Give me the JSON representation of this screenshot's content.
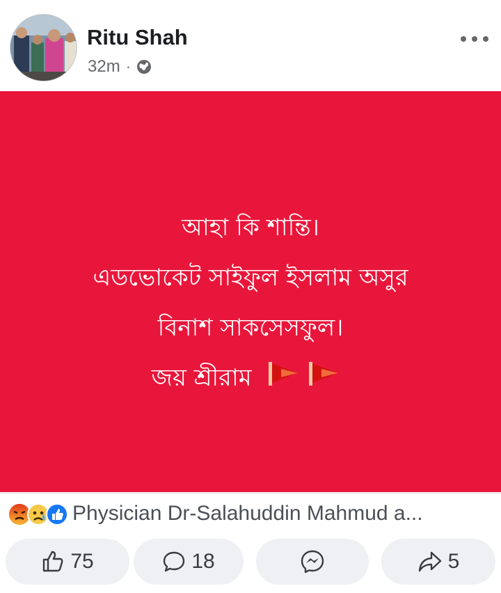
{
  "post": {
    "author": "Ritu Shah",
    "time": "32m",
    "separator": "·",
    "privacy_icon": "globe-icon",
    "more_icon": "more-dots-icon"
  },
  "image": {
    "background": "#e9163b",
    "lines": [
      "আহা কি শান্তি।",
      "এডভোকেট সাইফুল ইসলাম অসুর",
      "বিনাশ সাকসেসফুল।",
      "জয় শ্রীরাম"
    ],
    "flags_icon": "red-flags-icon"
  },
  "reactions": {
    "icons": [
      "angry-icon",
      "sad-icon",
      "like-icon"
    ],
    "text": "Physician Dr-Salahuddin Mahmud a..."
  },
  "actions": {
    "like_count": "75",
    "comment_count": "18",
    "share_count": "5"
  }
}
